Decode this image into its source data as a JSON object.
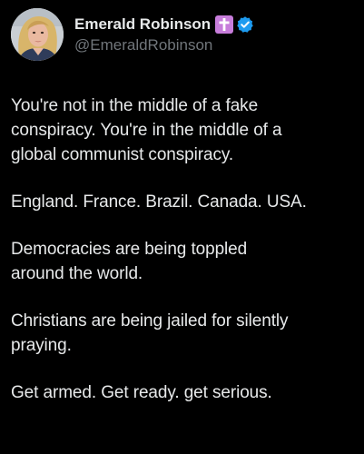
{
  "author": {
    "display_name": "Emerald Robinson",
    "handle": "@EmeraldRobinson",
    "avatar_icon": "profile-photo",
    "badges": {
      "cross_icon": "cross-icon",
      "cross_color": "#c77ddb",
      "verified_icon": "verified-check-icon",
      "verified_color": "#1d9bf0"
    }
  },
  "tweet": {
    "paragraphs": [
      "You're not in the middle of a fake\nconspiracy. You're in the middle of a\nglobal communist conspiracy.",
      "England. France. Brazil. Canada. USA.",
      "Democracies are being toppled\naround the world.",
      "Christians are being jailed for silently\npraying.",
      "Get armed. Get ready. get serious."
    ]
  },
  "colors": {
    "background": "#000000",
    "text": "#e7e9ea",
    "secondary_text": "#71767b"
  }
}
